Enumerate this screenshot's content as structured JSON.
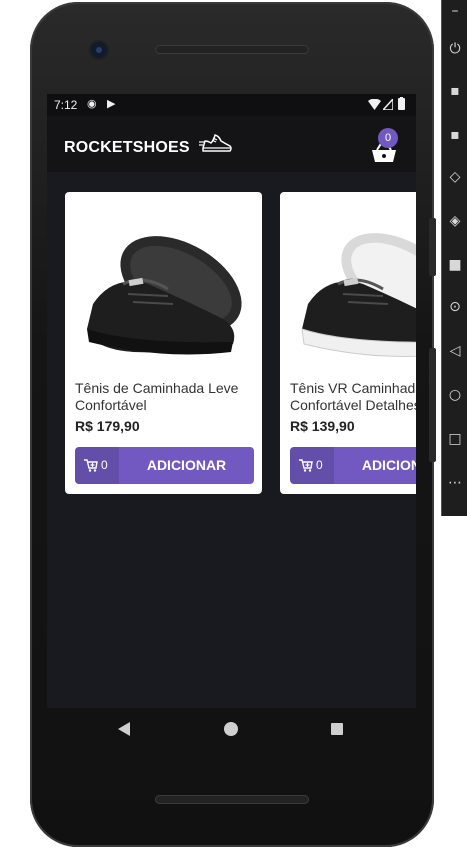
{
  "status_bar": {
    "time": "7:12"
  },
  "header": {
    "brand": "ROCKETSHOES",
    "cart_count": "0"
  },
  "products": [
    {
      "title": "Tênis de Caminhada Leve Confortável",
      "price": "R$ 179,90",
      "amount": "0",
      "button_label": "ADICIONAR",
      "shoe_color": "black"
    },
    {
      "title": "Tênis VR Caminhada Confortável Detalhes",
      "price": "R$ 139,90",
      "amount": "0",
      "button_label": "ADICIONAR",
      "shoe_color": "black-white"
    }
  ],
  "theme": {
    "accent": "#7159c1",
    "background": "#191920",
    "header_bg": "#141417"
  },
  "side_toolbar": {
    "icons": [
      "minimize-icon",
      "power-icon",
      "volume-up-icon",
      "volume-down-icon",
      "rotate-left-icon",
      "rotate-right-icon",
      "camera-icon",
      "zoom-icon",
      "back-icon",
      "home-icon",
      "overview-icon",
      "more-icon"
    ]
  }
}
